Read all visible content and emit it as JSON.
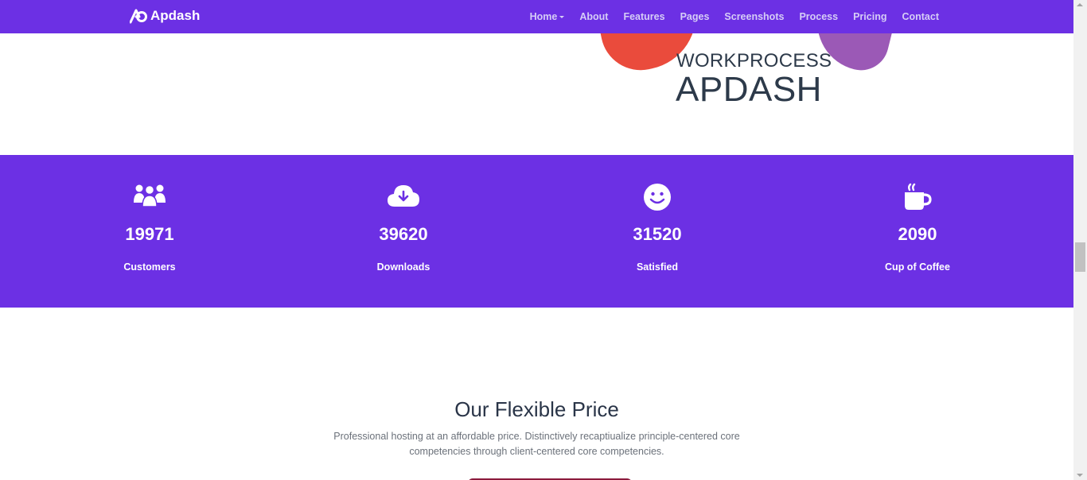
{
  "brand": {
    "name": "Apdash",
    "logo_icon": "apdash-logo-icon"
  },
  "nav": {
    "items": [
      {
        "label": "Home",
        "dropdown": true
      },
      {
        "label": "About"
      },
      {
        "label": "Features"
      },
      {
        "label": "Pages"
      },
      {
        "label": "Screenshots"
      },
      {
        "label": "Process"
      },
      {
        "label": "Pricing"
      },
      {
        "label": "Contact"
      }
    ]
  },
  "hero": {
    "small_text": "WORKPROCESS",
    "big_text": "APDASH"
  },
  "counters": [
    {
      "icon": "users-icon",
      "value": "19971",
      "label": "Customers"
    },
    {
      "icon": "cloud-download-icon",
      "value": "39620",
      "label": "Downloads"
    },
    {
      "icon": "smile-icon",
      "value": "31520",
      "label": "Satisfied"
    },
    {
      "icon": "coffee-cup-icon",
      "value": "2090",
      "label": "Cup of Coffee"
    }
  ],
  "pricing": {
    "title": "Our Flexible Price",
    "description": "Professional hosting at an affordable price. Distinctively recaptiualize principle-centered core competencies through client-centered core competencies."
  },
  "colors": {
    "primary": "#6c30e4",
    "heading": "#2a3548",
    "accent_red": "#ea4b3c",
    "accent_purple": "#9b59b6"
  }
}
